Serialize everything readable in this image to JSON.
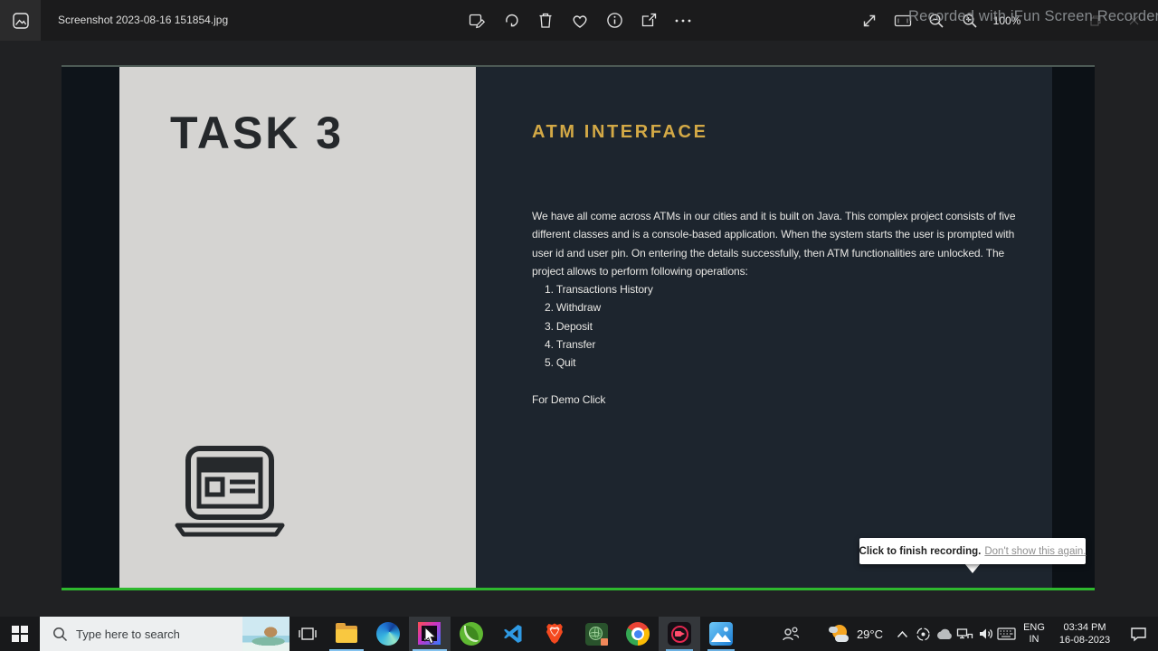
{
  "app": {
    "title": "Screenshot 2023-08-16 151854.jpg",
    "zoom_level": "100%",
    "toolbar_icons": [
      "edit",
      "rotate",
      "delete",
      "favorite",
      "info",
      "share",
      "more"
    ],
    "view_control_icons": [
      "resize",
      "slideshow",
      "zoom-out",
      "zoom-in"
    ],
    "window_control_icons": [
      "restore",
      "close"
    ]
  },
  "watermark": "Recorded with iFun Screen Recorder",
  "slide": {
    "task_title": "TASK 3",
    "heading": "ATM INTERFACE",
    "body": "We have all come across ATMs in our cities and it is built on Java. This complex project consists of five different classes and is a console-based application. When the system starts the user is prompted with user id and user pin. On entering the details successfully, then ATM functionalities are unlocked. The project allows to perform following operations:",
    "operations": [
      "Transactions History",
      "Withdraw",
      "Deposit",
      "Transfer",
      "Quit"
    ],
    "demo_label": "For Demo Click",
    "laptop_icon": "laptop-browser-icon"
  },
  "recorder_tooltip": {
    "message": "Click to finish recording.",
    "link": "Don't show this again."
  },
  "taskbar": {
    "search_placeholder": "Type here to search",
    "apps": [
      "task-view",
      "file-explorer",
      "edge",
      "intellij-idea",
      "spring-tool-suite",
      "vscode",
      "brave",
      "eclipse",
      "chrome",
      "ifun-screen-recorder",
      "photos"
    ],
    "tray_icons": [
      "people",
      "weather",
      "hidden-icons-chevron",
      "recorder-tray",
      "onedrive-cloud",
      "network",
      "volume",
      "touch-keyboard",
      "language",
      "clock",
      "action-center"
    ],
    "tray": {
      "temperature": "29°C",
      "language": "ENG",
      "region": "IN",
      "time": "03:34 PM",
      "date": "16-08-2023"
    }
  },
  "colors": {
    "accent_gold": "#d3a946",
    "record_green": "#2eb82e",
    "taskbar_underline_blue": "#6cb1e2",
    "slide_dark": "#1d252e",
    "slide_light": "#d5d4d2"
  }
}
